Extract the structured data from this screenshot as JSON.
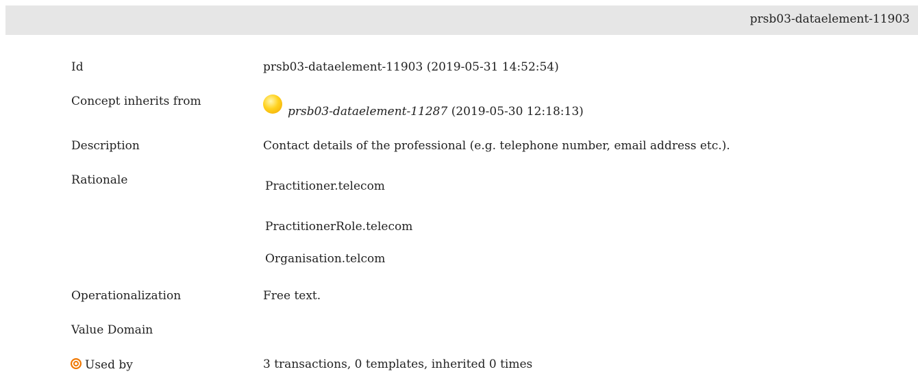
{
  "header": {
    "title": "prsb03-dataelement-11903"
  },
  "rows": {
    "id": {
      "label": "Id",
      "value": "prsb03-dataelement-11903 (2019-05-31 14:52:54)"
    },
    "inherits": {
      "label": "Concept inherits from",
      "link": "prsb03-dataelement-11287",
      "date": " (2019-05-30 12:18:13)",
      "icon": "yellow-orb-icon"
    },
    "description": {
      "label": "Description",
      "value": "Contact details of the professional (e.g. telephone number, email address etc.)."
    },
    "rationale": {
      "label": "Rationale",
      "lines": [
        "Practitioner.telecom",
        "PractitionerRole.telecom",
        "Organisation.telcom"
      ]
    },
    "operationalization": {
      "label": "Operationalization",
      "value": "Free text."
    },
    "value_domain": {
      "label": "Value Domain"
    },
    "used_by": {
      "label": "Used by",
      "icon": "target-icon",
      "value": "3 transactions, 0 templates, inherited 0 times"
    }
  },
  "colors": {
    "header_bg": "#e6e6e6",
    "orb": "#ffd21f",
    "target": "#f07800"
  }
}
